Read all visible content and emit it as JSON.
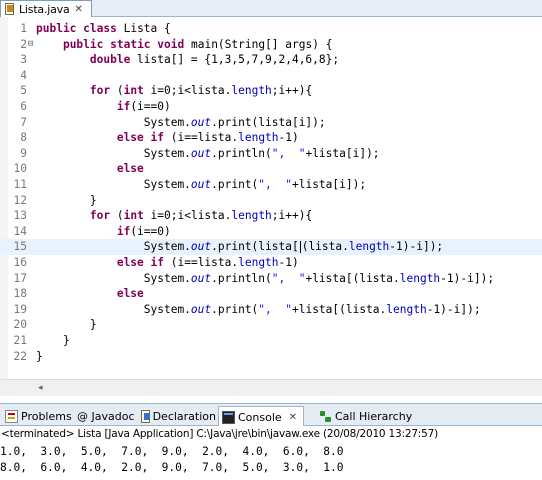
{
  "editor_tab": {
    "filename": "Lista.java",
    "close_glyph": "✕"
  },
  "code_lines": [
    {
      "n": "1",
      "fold": "",
      "current": false,
      "segments": [
        [
          "kw",
          "public"
        ],
        [
          "t",
          " "
        ],
        [
          "kw",
          "class"
        ],
        [
          "t",
          " Lista {"
        ]
      ]
    },
    {
      "n": "2",
      "fold": "⊟",
      "current": false,
      "segments": [
        [
          "t",
          "    "
        ],
        [
          "kw",
          "public"
        ],
        [
          "t",
          " "
        ],
        [
          "kw",
          "static"
        ],
        [
          "t",
          " "
        ],
        [
          "kw",
          "void"
        ],
        [
          "t",
          " main(String[] args) {"
        ]
      ]
    },
    {
      "n": "3",
      "fold": "",
      "current": false,
      "segments": [
        [
          "t",
          "        "
        ],
        [
          "kw",
          "double"
        ],
        [
          "t",
          " lista[] = {1,3,5,7,9,2,4,6,8};"
        ]
      ]
    },
    {
      "n": "4",
      "fold": "",
      "current": false,
      "segments": []
    },
    {
      "n": "5",
      "fold": "",
      "current": false,
      "segments": [
        [
          "t",
          "        "
        ],
        [
          "kw",
          "for"
        ],
        [
          "t",
          " ("
        ],
        [
          "kw",
          "int"
        ],
        [
          "t",
          " i=0;i<lista."
        ],
        [
          "fld2",
          "length"
        ],
        [
          "t",
          ";i++){"
        ]
      ]
    },
    {
      "n": "6",
      "fold": "",
      "current": false,
      "segments": [
        [
          "t",
          "            "
        ],
        [
          "kw",
          "if"
        ],
        [
          "t",
          "(i==0)"
        ]
      ]
    },
    {
      "n": "7",
      "fold": "",
      "current": false,
      "segments": [
        [
          "t",
          "                System."
        ],
        [
          "fld",
          "out"
        ],
        [
          "t",
          ".print(lista[i]);"
        ]
      ]
    },
    {
      "n": "8",
      "fold": "",
      "current": false,
      "segments": [
        [
          "t",
          "            "
        ],
        [
          "kw",
          "else"
        ],
        [
          "t",
          " "
        ],
        [
          "kw",
          "if"
        ],
        [
          "t",
          " (i==lista."
        ],
        [
          "fld2",
          "length"
        ],
        [
          "t",
          "-1)"
        ]
      ]
    },
    {
      "n": "9",
      "fold": "",
      "current": false,
      "segments": [
        [
          "t",
          "                System."
        ],
        [
          "fld",
          "out"
        ],
        [
          "t",
          ".println("
        ],
        [
          "str",
          "\",  \""
        ],
        [
          "t",
          "+lista[i]);"
        ]
      ]
    },
    {
      "n": "10",
      "fold": "",
      "current": false,
      "segments": [
        [
          "t",
          "            "
        ],
        [
          "kw",
          "else"
        ]
      ]
    },
    {
      "n": "11",
      "fold": "",
      "current": false,
      "segments": [
        [
          "t",
          "                System."
        ],
        [
          "fld",
          "out"
        ],
        [
          "t",
          ".print("
        ],
        [
          "str",
          "\",  \""
        ],
        [
          "t",
          "+lista[i]);"
        ]
      ]
    },
    {
      "n": "12",
      "fold": "",
      "current": false,
      "segments": [
        [
          "t",
          "        }"
        ]
      ]
    },
    {
      "n": "13",
      "fold": "",
      "current": false,
      "segments": [
        [
          "t",
          "        "
        ],
        [
          "kw",
          "for"
        ],
        [
          "t",
          " ("
        ],
        [
          "kw",
          "int"
        ],
        [
          "t",
          " i=0;i<lista."
        ],
        [
          "fld2",
          "length"
        ],
        [
          "t",
          ";i++){"
        ]
      ]
    },
    {
      "n": "14",
      "fold": "",
      "current": false,
      "segments": [
        [
          "t",
          "            "
        ],
        [
          "kw",
          "if"
        ],
        [
          "t",
          "(i==0)"
        ]
      ]
    },
    {
      "n": "15",
      "fold": "",
      "current": true,
      "segments": [
        [
          "t",
          "                System."
        ],
        [
          "fld",
          "out"
        ],
        [
          "t",
          ".print(lista["
        ],
        [
          "cursor",
          ""
        ],
        [
          "t",
          "(lista."
        ],
        [
          "fld2",
          "length"
        ],
        [
          "t",
          "-1)-i]);"
        ]
      ]
    },
    {
      "n": "16",
      "fold": "",
      "current": false,
      "segments": [
        [
          "t",
          "            "
        ],
        [
          "kw",
          "else"
        ],
        [
          "t",
          " "
        ],
        [
          "kw",
          "if"
        ],
        [
          "t",
          " (i==lista."
        ],
        [
          "fld2",
          "length"
        ],
        [
          "t",
          "-1)"
        ]
      ]
    },
    {
      "n": "17",
      "fold": "",
      "current": false,
      "segments": [
        [
          "t",
          "                System."
        ],
        [
          "fld",
          "out"
        ],
        [
          "t",
          ".println("
        ],
        [
          "str",
          "\",  \""
        ],
        [
          "t",
          "+lista[(lista."
        ],
        [
          "fld2",
          "length"
        ],
        [
          "t",
          "-1)-i]);"
        ]
      ]
    },
    {
      "n": "18",
      "fold": "",
      "current": false,
      "segments": [
        [
          "t",
          "            "
        ],
        [
          "kw",
          "else"
        ]
      ]
    },
    {
      "n": "19",
      "fold": "",
      "current": false,
      "segments": [
        [
          "t",
          "                System."
        ],
        [
          "fld",
          "out"
        ],
        [
          "t",
          ".print("
        ],
        [
          "str",
          "\",  \""
        ],
        [
          "t",
          "+lista[(lista."
        ],
        [
          "fld2",
          "length"
        ],
        [
          "t",
          "-1)-i]);"
        ]
      ]
    },
    {
      "n": "20",
      "fold": "",
      "current": false,
      "segments": [
        [
          "t",
          "        }"
        ]
      ]
    },
    {
      "n": "21",
      "fold": "",
      "current": false,
      "segments": [
        [
          "t",
          "    }"
        ]
      ]
    },
    {
      "n": "22",
      "fold": "",
      "current": false,
      "segments": [
        [
          "t",
          "}"
        ]
      ]
    }
  ],
  "scrollbar": {
    "left_arrow": "◂"
  },
  "panel_tabs": [
    {
      "label": "Problems",
      "icon": "problems-icon",
      "active": false
    },
    {
      "label": "@ Javadoc",
      "icon": "javadoc-icon",
      "active": false
    },
    {
      "label": "Declaration",
      "icon": "declaration-icon",
      "active": false
    },
    {
      "label": "Console",
      "icon": "console-icon",
      "active": true,
      "close": "✕"
    },
    {
      "label": "Call Hierarchy",
      "icon": "call-hierarchy-icon",
      "active": false
    }
  ],
  "console": {
    "terminated": "<terminated> Lista [Java Application] C:\\Java\\jre\\bin\\javaw.exe (20/08/2010 13:27:57)",
    "output_lines": [
      "1.0,  3.0,  5.0,  7.0,  9.0,  2.0,  4.0,  6.0,  8.0",
      "8.0,  6.0,  4.0,  2.0,  9.0,  7.0,  5.0,  3.0,  1.0"
    ]
  }
}
